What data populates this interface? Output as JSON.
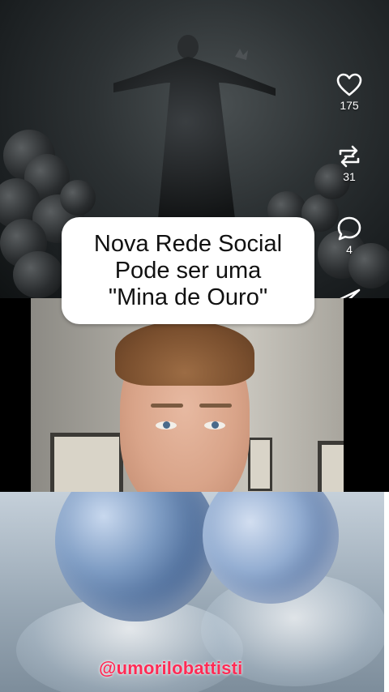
{
  "actions": {
    "like": {
      "icon": "heart-icon",
      "count": "175"
    },
    "repost": {
      "icon": "repost-icon",
      "count": "31"
    },
    "comment": {
      "icon": "comment-icon",
      "count": "4"
    },
    "share": {
      "icon": "share-icon"
    }
  },
  "title_card": {
    "lines": [
      "Nova Rede Social",
      "Pode ser uma",
      "\"Mina de Ouro\""
    ]
  },
  "watermark": "@umorilobattisti",
  "colors": {
    "watermark": "#ff2b55",
    "card_background": "#ffffff",
    "icon": "#ffffff"
  }
}
